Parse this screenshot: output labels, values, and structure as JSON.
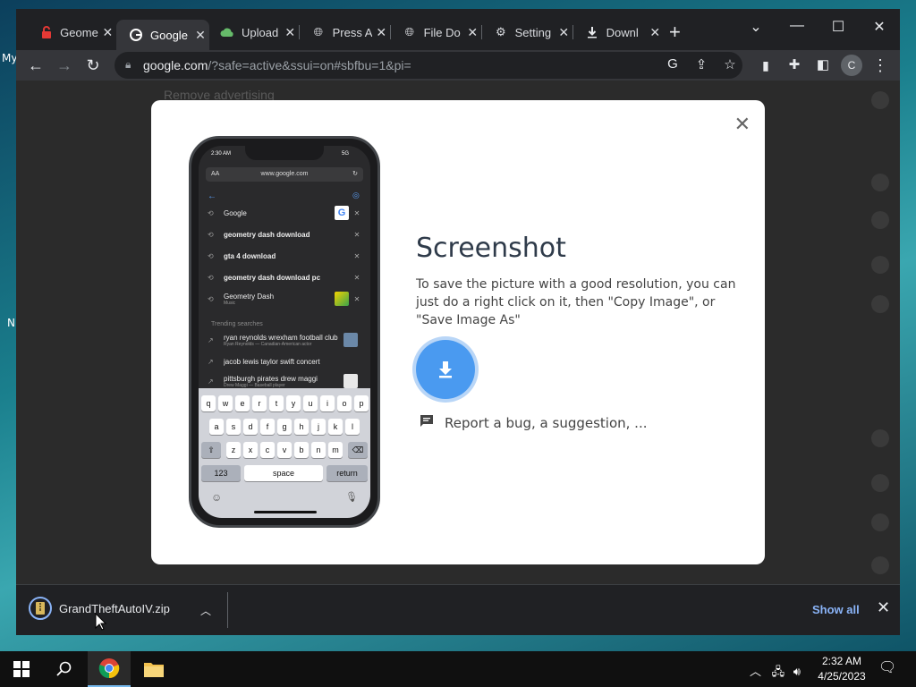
{
  "desktop": {
    "icon_labels": [
      "My",
      "N"
    ]
  },
  "browser": {
    "tabs": [
      {
        "label": "Geome",
        "icon": "lock-red-icon",
        "active": false
      },
      {
        "label": "Google",
        "icon": "google-g-icon",
        "active": true
      },
      {
        "label": "Upload",
        "icon": "cloud-upload-icon",
        "active": false
      },
      {
        "label": "Press A",
        "icon": "globe-icon",
        "active": false
      },
      {
        "label": "File Do",
        "icon": "globe-icon",
        "active": false
      },
      {
        "label": "Setting",
        "icon": "gear-icon",
        "active": false
      },
      {
        "label": "Downl",
        "icon": "download-icon",
        "active": false
      }
    ],
    "new_tab": "+",
    "window_controls": {
      "minimize": "—",
      "maximize": "☐",
      "close": "✕",
      "tab_search": "⌄"
    },
    "address": {
      "host": "google.com",
      "path": "/?safe=active&ssui=on#sbfbu=1&pi="
    },
    "profile_initial": "C"
  },
  "page": {
    "background_text": "Remove advertising"
  },
  "modal": {
    "title": "Screenshot",
    "description": "To save the picture with a good resolution, you can just do a right click on it, then \"Copy Image\", or \"Save Image As\"",
    "report_link": "Report a bug, a suggestion, ...",
    "close": "✕"
  },
  "phone": {
    "time": "2:30 AM",
    "signal": "5G",
    "font_size_label": "AA",
    "url": "www.google.com",
    "suggestions": [
      {
        "text": "Google",
        "sub": "",
        "bold": false,
        "thumb": "google"
      },
      {
        "text": "geometry dash download",
        "sub": "",
        "bold": true,
        "thumb": ""
      },
      {
        "text": "gta 4 download",
        "sub": "",
        "bold": true,
        "thumb": ""
      },
      {
        "text": "geometry dash download pc",
        "sub": "",
        "bold": true,
        "thumb": ""
      },
      {
        "text": "Geometry Dash",
        "sub": "Music",
        "bold": false,
        "thumb": "gd"
      }
    ],
    "trending_label": "Trending searches",
    "trending": [
      {
        "text": "ryan reynolds wrexham football club",
        "sub": "Ryan Reynolds — Canadian-American actor",
        "thumb": "person"
      },
      {
        "text": "jacob lewis taylor swift concert",
        "sub": "",
        "thumb": ""
      },
      {
        "text": "pittsburgh pirates drew maggi",
        "sub": "Drew Maggi — Baseball player",
        "thumb": "person"
      }
    ],
    "keyboard": {
      "row1": [
        "q",
        "w",
        "e",
        "r",
        "t",
        "y",
        "u",
        "i",
        "o",
        "p"
      ],
      "row2": [
        "a",
        "s",
        "d",
        "f",
        "g",
        "h",
        "j",
        "k",
        "l"
      ],
      "row3": [
        "z",
        "x",
        "c",
        "v",
        "b",
        "n",
        "m"
      ],
      "num": "123",
      "space": "space",
      "return": "return"
    }
  },
  "downloads": {
    "file": "GrandTheftAutoIV.zip",
    "show_all": "Show all"
  },
  "taskbar": {
    "time": "2:32 AM",
    "date": "4/25/2023"
  },
  "colors": {
    "accent": "#4a9af0",
    "link": "#8ab4f8",
    "chrome_dark": "#202124",
    "toolbar": "#35363a"
  }
}
